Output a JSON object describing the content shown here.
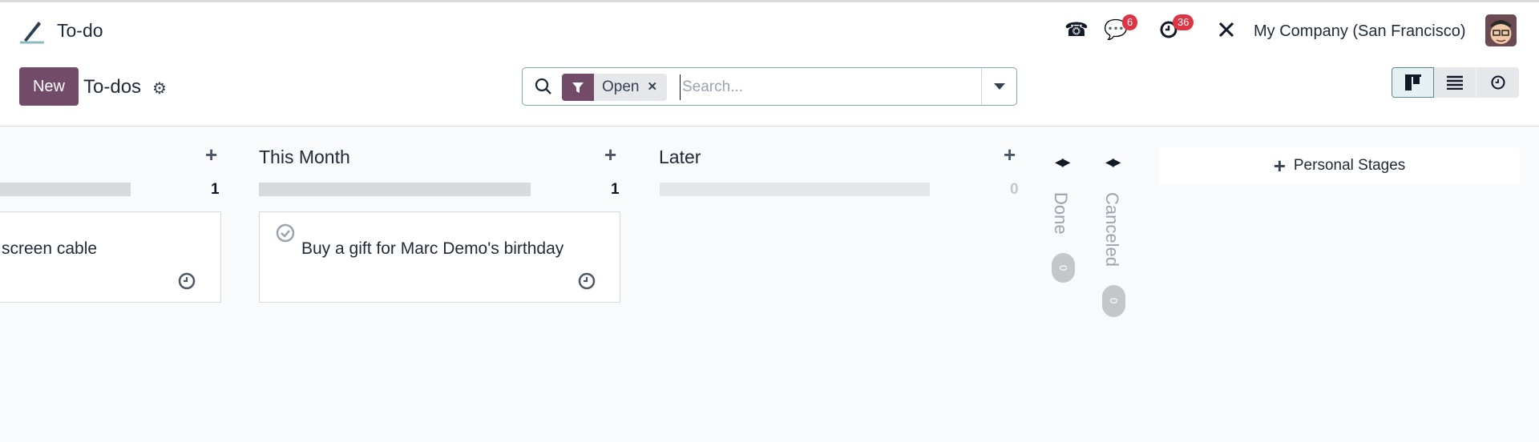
{
  "navbar": {
    "app_name": "To-do",
    "icons": [
      "phone-icon",
      "chat-icon",
      "activity-clock-icon",
      "tools-icon"
    ],
    "messages_badge": "6",
    "activities_badge": "36",
    "company": "My Company (San Francisco)"
  },
  "control_panel": {
    "new_label": "New",
    "title": "To-dos",
    "search": {
      "facet_label": "Open",
      "placeholder": "Search..."
    },
    "views": [
      "kanban",
      "list",
      "activity"
    ],
    "active_view": "kanban"
  },
  "kanban": {
    "columns": [
      {
        "title": "",
        "count": "1",
        "cards": [
          {
            "title": "screen cable"
          }
        ]
      },
      {
        "title": "This Month",
        "count": "1",
        "cards": [
          {
            "title": "Buy a gift for Marc Demo's birthday"
          }
        ]
      },
      {
        "title": "Later",
        "count": "0",
        "cards": []
      }
    ],
    "folded": [
      {
        "title": "Done",
        "count": "0"
      },
      {
        "title": "Canceled",
        "count": "0"
      }
    ],
    "add_stage_label": "Personal Stages"
  },
  "colors": {
    "brand": "#714b67",
    "badge": "#dc3545"
  }
}
